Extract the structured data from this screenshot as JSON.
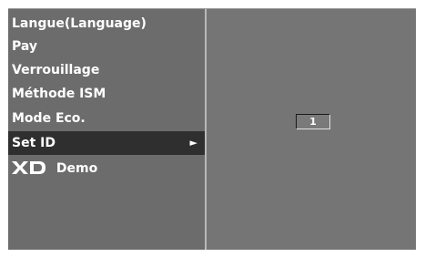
{
  "menu": {
    "items": [
      {
        "label": "Langue(Language)"
      },
      {
        "label": "Pay"
      },
      {
        "label": "Verrouillage"
      },
      {
        "label": "Méthode ISM"
      },
      {
        "label": "Mode Eco."
      },
      {
        "label": "Set ID",
        "selected": true,
        "arrow": "►"
      },
      {
        "label": "Demo",
        "logo_text": "XD",
        "icon": "xd-logo"
      }
    ]
  },
  "set_id": {
    "value": "1"
  },
  "colors": {
    "panel_bg": "#6c6c6c",
    "selected_bg": "#2f2f2f",
    "text": "#ffffff",
    "divider": "#b9b9b9"
  }
}
